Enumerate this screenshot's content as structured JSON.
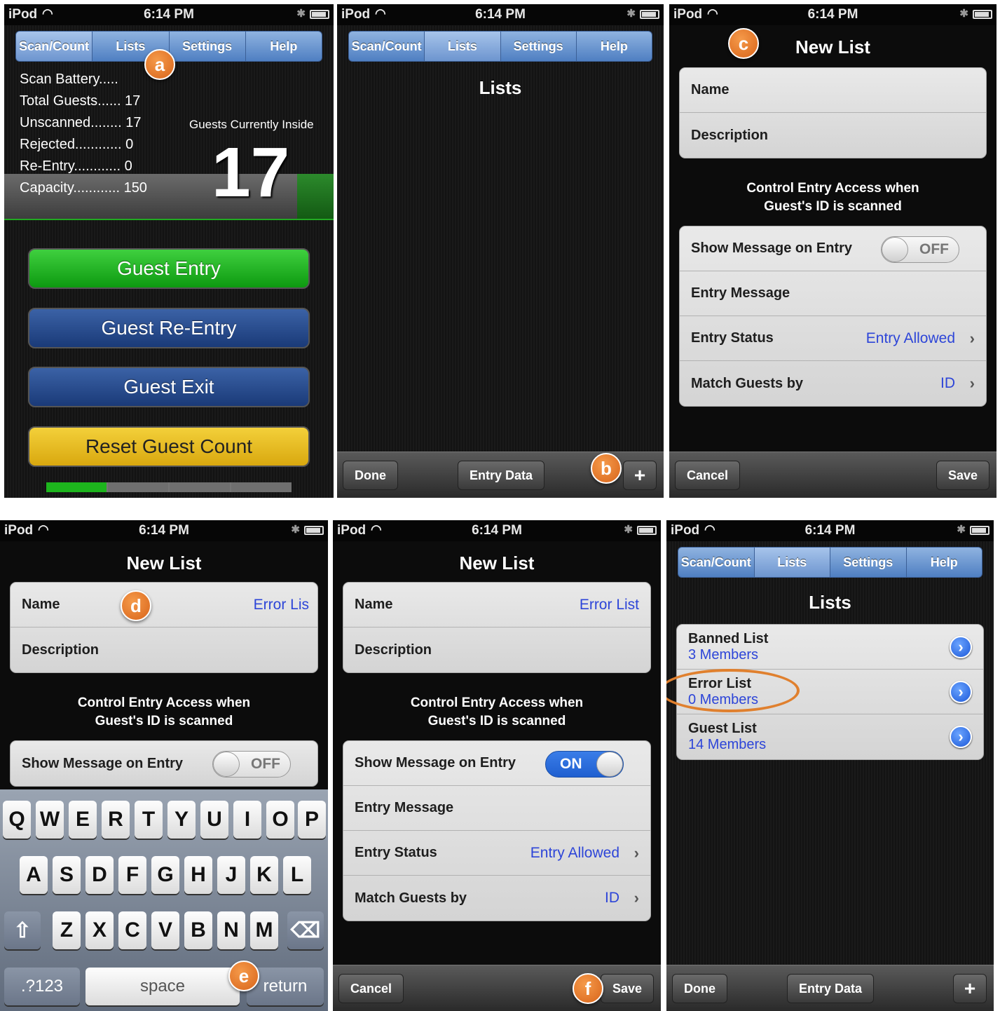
{
  "status": {
    "carrier": "iPod",
    "time": "6:14 PM"
  },
  "tabs": [
    "Scan/Count",
    "Lists",
    "Settings",
    "Help"
  ],
  "panel_a": {
    "marker": "a",
    "stats": [
      "Scan Battery.....",
      "Total Guests...... 17",
      "Unscanned........ 17",
      "Rejected............ 0",
      "Re-Entry............ 0",
      "Capacity............ 150"
    ],
    "inside_label": "Guests Currently Inside",
    "inside_count": "17",
    "buttons": [
      "Guest Entry",
      "Guest Re-Entry",
      "Guest Exit",
      "Reset Guest Count"
    ]
  },
  "panel_b": {
    "marker": "b",
    "title": "Lists",
    "done": "Done",
    "entry_data": "Entry Data",
    "add": "+"
  },
  "new_list": {
    "title": "New List",
    "name_label": "Name",
    "desc_label": "Description",
    "caption_line1": "Control Entry Access when",
    "caption_line2": "Guest's ID is scanned",
    "show_msg_label": "Show Message on Entry",
    "toggle_off": "OFF",
    "toggle_on": "ON",
    "entry_msg_label": "Entry Message",
    "entry_status_label": "Entry Status",
    "entry_status_value": "Entry Allowed",
    "match_label": "Match Guests by",
    "match_value": "ID",
    "cancel": "Cancel",
    "save": "Save"
  },
  "panel_c": {
    "marker": "c"
  },
  "panel_d": {
    "marker": "d",
    "name_value": "Error Lis"
  },
  "panel_e": {
    "marker": "e"
  },
  "keyboard": {
    "row1": [
      "Q",
      "W",
      "E",
      "R",
      "T",
      "Y",
      "U",
      "I",
      "O",
      "P"
    ],
    "row2": [
      "A",
      "S",
      "D",
      "F",
      "G",
      "H",
      "J",
      "K",
      "L"
    ],
    "row3": [
      "Z",
      "X",
      "C",
      "V",
      "B",
      "N",
      "M"
    ],
    "shift": "⇧",
    "del": "⌫",
    "num": ".?123",
    "space": "space",
    "return": "return"
  },
  "panel_f": {
    "marker": "f",
    "name_value": "Error List"
  },
  "panel_g": {
    "title": "Lists",
    "items": [
      {
        "name": "Banned List",
        "members": "3 Members"
      },
      {
        "name": "Error  List",
        "members": "0 Members"
      },
      {
        "name": "Guest List",
        "members": "14 Members"
      }
    ],
    "done": "Done",
    "entry_data": "Entry Data",
    "add": "+"
  },
  "colors": {
    "accent_blue": "#2d45d8",
    "marker_orange": "#e0702a",
    "entry_green": "#16a818",
    "reset_yellow": "#e8bc22"
  }
}
